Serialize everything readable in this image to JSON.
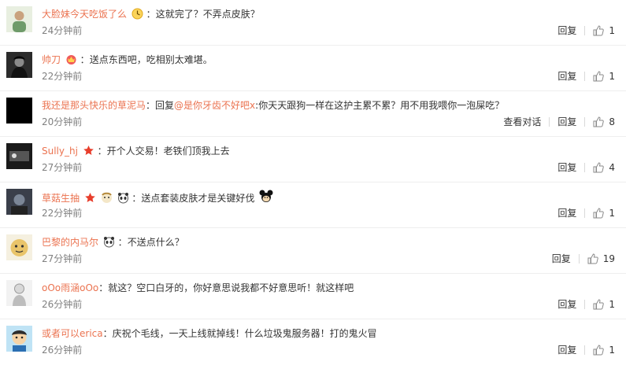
{
  "comments": [
    {
      "user": "大脸妹今天吃饭了么",
      "badge": "clock-emoji",
      "text": "这就完了？不弄点皮肤？",
      "time": "24分钟前",
      "reply": "回复",
      "likes": "1"
    },
    {
      "user": "帅刀",
      "badge": "crown-emoji",
      "text": "送点东西吧，吃相别太难堪。",
      "time": "22分钟前",
      "reply": "回复",
      "likes": "1"
    },
    {
      "user": "我还是那头快乐的草泥马",
      "prefix": "回复",
      "mention": "@是你牙齿不好吧x",
      "text": "你天天跟狗一样在这护主累不累？用不用我喂你一泡屎吃？",
      "time": "20分钟前",
      "view": "查看对话",
      "reply": "回复",
      "likes": "8"
    },
    {
      "user": "Sully_hj",
      "badge": "star-badge",
      "text": "开个人交易！老铁们顶我上去",
      "time": "27分钟前",
      "reply": "回复",
      "likes": "4"
    },
    {
      "user": "草菇生抽",
      "badge": "star-badge",
      "text": "送点套装皮肤才是关键好伐",
      "time": "22分钟前",
      "reply": "回复",
      "likes": "1"
    },
    {
      "user": "巴黎的内马尔",
      "text": "不送点什么？",
      "time": "27分钟前",
      "reply": "回复",
      "likes": "19"
    },
    {
      "user": "oOo雨涵oOo",
      "text": "就这？空口白牙的，你好意思说我都不好意思听！就这样吧",
      "time": "26分钟前",
      "reply": "回复",
      "likes": "1"
    },
    {
      "user": "或者可以erica",
      "text": "庆祝个毛线，一天上线就掉线！什么垃圾鬼服务器！打的鬼火冒",
      "time": "26分钟前",
      "reply": "回复",
      "likes": "1"
    }
  ],
  "colors": {
    "username": "#eb7350",
    "time": "#808080",
    "text": "#333333"
  }
}
